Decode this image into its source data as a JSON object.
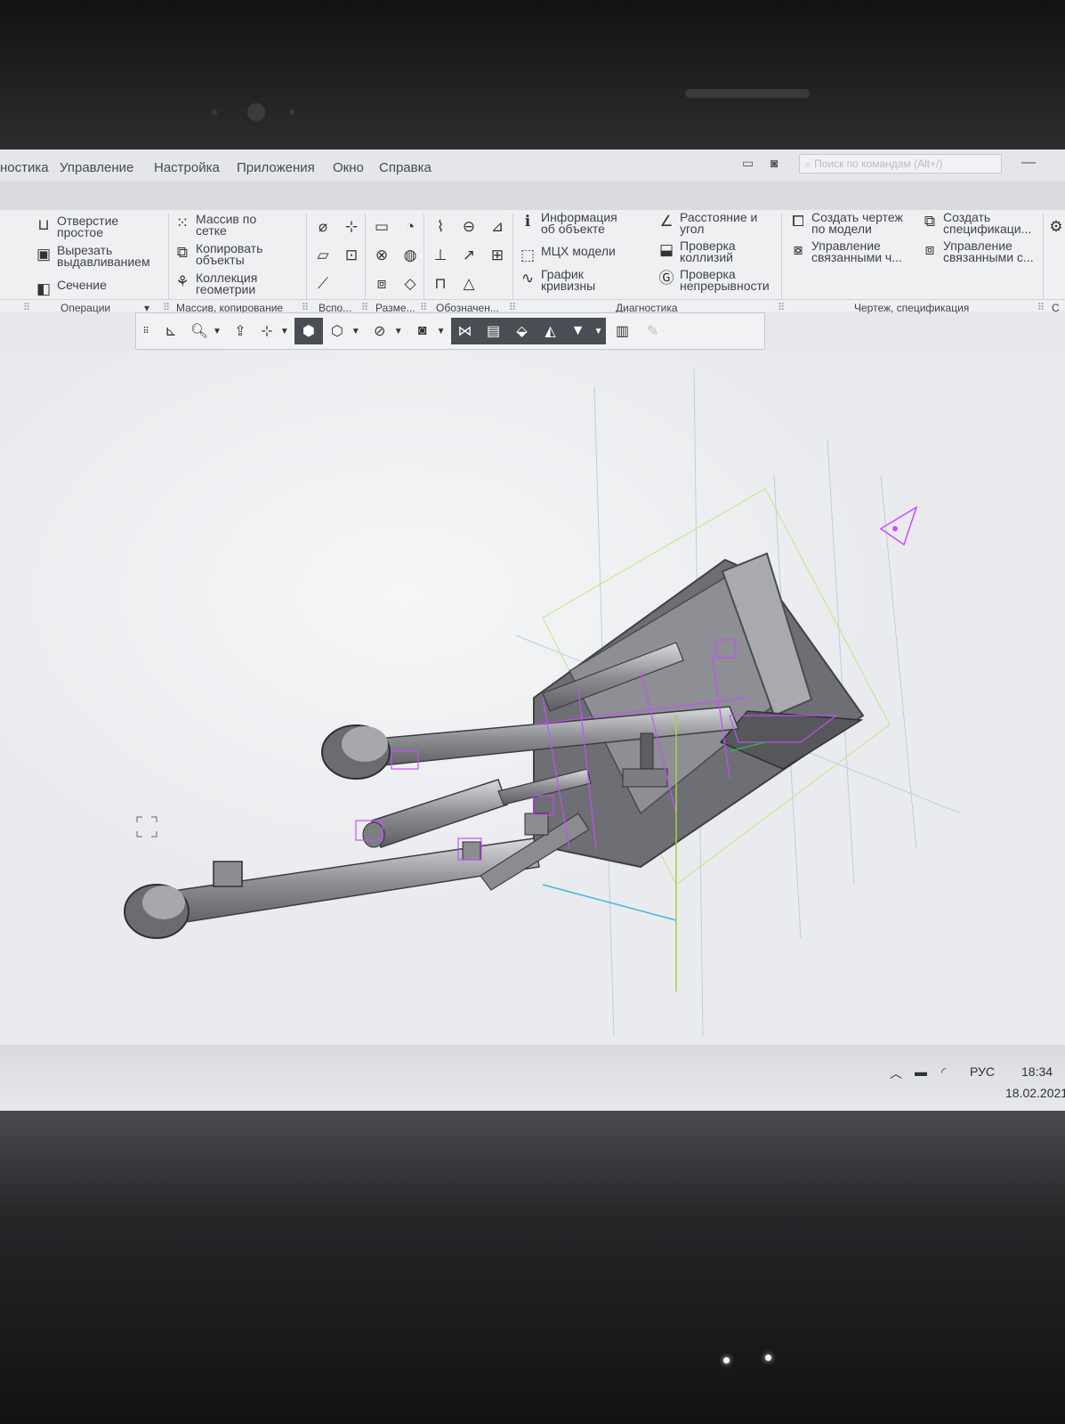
{
  "menu": {
    "items": [
      "ностика",
      "Управление",
      "Настройка",
      "Приложения",
      "Окно",
      "Справка"
    ],
    "search_placeholder": "Поиск по командам (Alt+/)"
  },
  "ribbon": {
    "operations": {
      "hole": [
        "Отверстие",
        "простое"
      ],
      "extrude_cut": [
        "Вырезать",
        "выдавливанием"
      ],
      "section": "Сечение"
    },
    "array": {
      "grid_array": [
        "Массив по",
        "сетке"
      ],
      "copy_objects": [
        "Копировать",
        "объекты"
      ],
      "geometry_collection": [
        "Коллекция",
        "геометрии"
      ]
    },
    "diagnostics": {
      "object_info": [
        "Информация",
        "об объекте"
      ],
      "mass_props": "МЦХ модели",
      "curvature_graph": [
        "График",
        "кривизны"
      ],
      "distance_angle": [
        "Расстояние и",
        "угол"
      ],
      "collision_check": [
        "Проверка",
        "коллизий"
      ],
      "continuity_check": [
        "Проверка",
        "непрерывности"
      ]
    },
    "drawing": {
      "create_drawing": [
        "Создать чертеж",
        "по модели"
      ],
      "manage_linked": [
        "Управление",
        "связанными ч..."
      ],
      "create_spec": [
        "Создать",
        "спецификаци..."
      ],
      "manage_linked_spec": [
        "Управление",
        "связанными с..."
      ]
    },
    "groups": {
      "operations": "Операции",
      "array_copy": "Массив, копирование",
      "aux": "Вспо...",
      "dims": "Разме...",
      "notation": "Обозначен...",
      "diagnostics": "Диагностика",
      "drawing_spec": "Чертеж, спецификация",
      "more": "С"
    }
  },
  "taskbar": {
    "lang": "РУС",
    "time": "18:34",
    "date": "18.02.2021"
  },
  "colors": {
    "selection": "#c94cff",
    "model_fill": "#8f9196",
    "model_dark": "#5f6166",
    "screen_bg": "#e6e8eb"
  },
  "icons": {
    "wifi": "wifi-icon",
    "battery": "battery-icon",
    "tray_up": "chevron-up-icon"
  }
}
